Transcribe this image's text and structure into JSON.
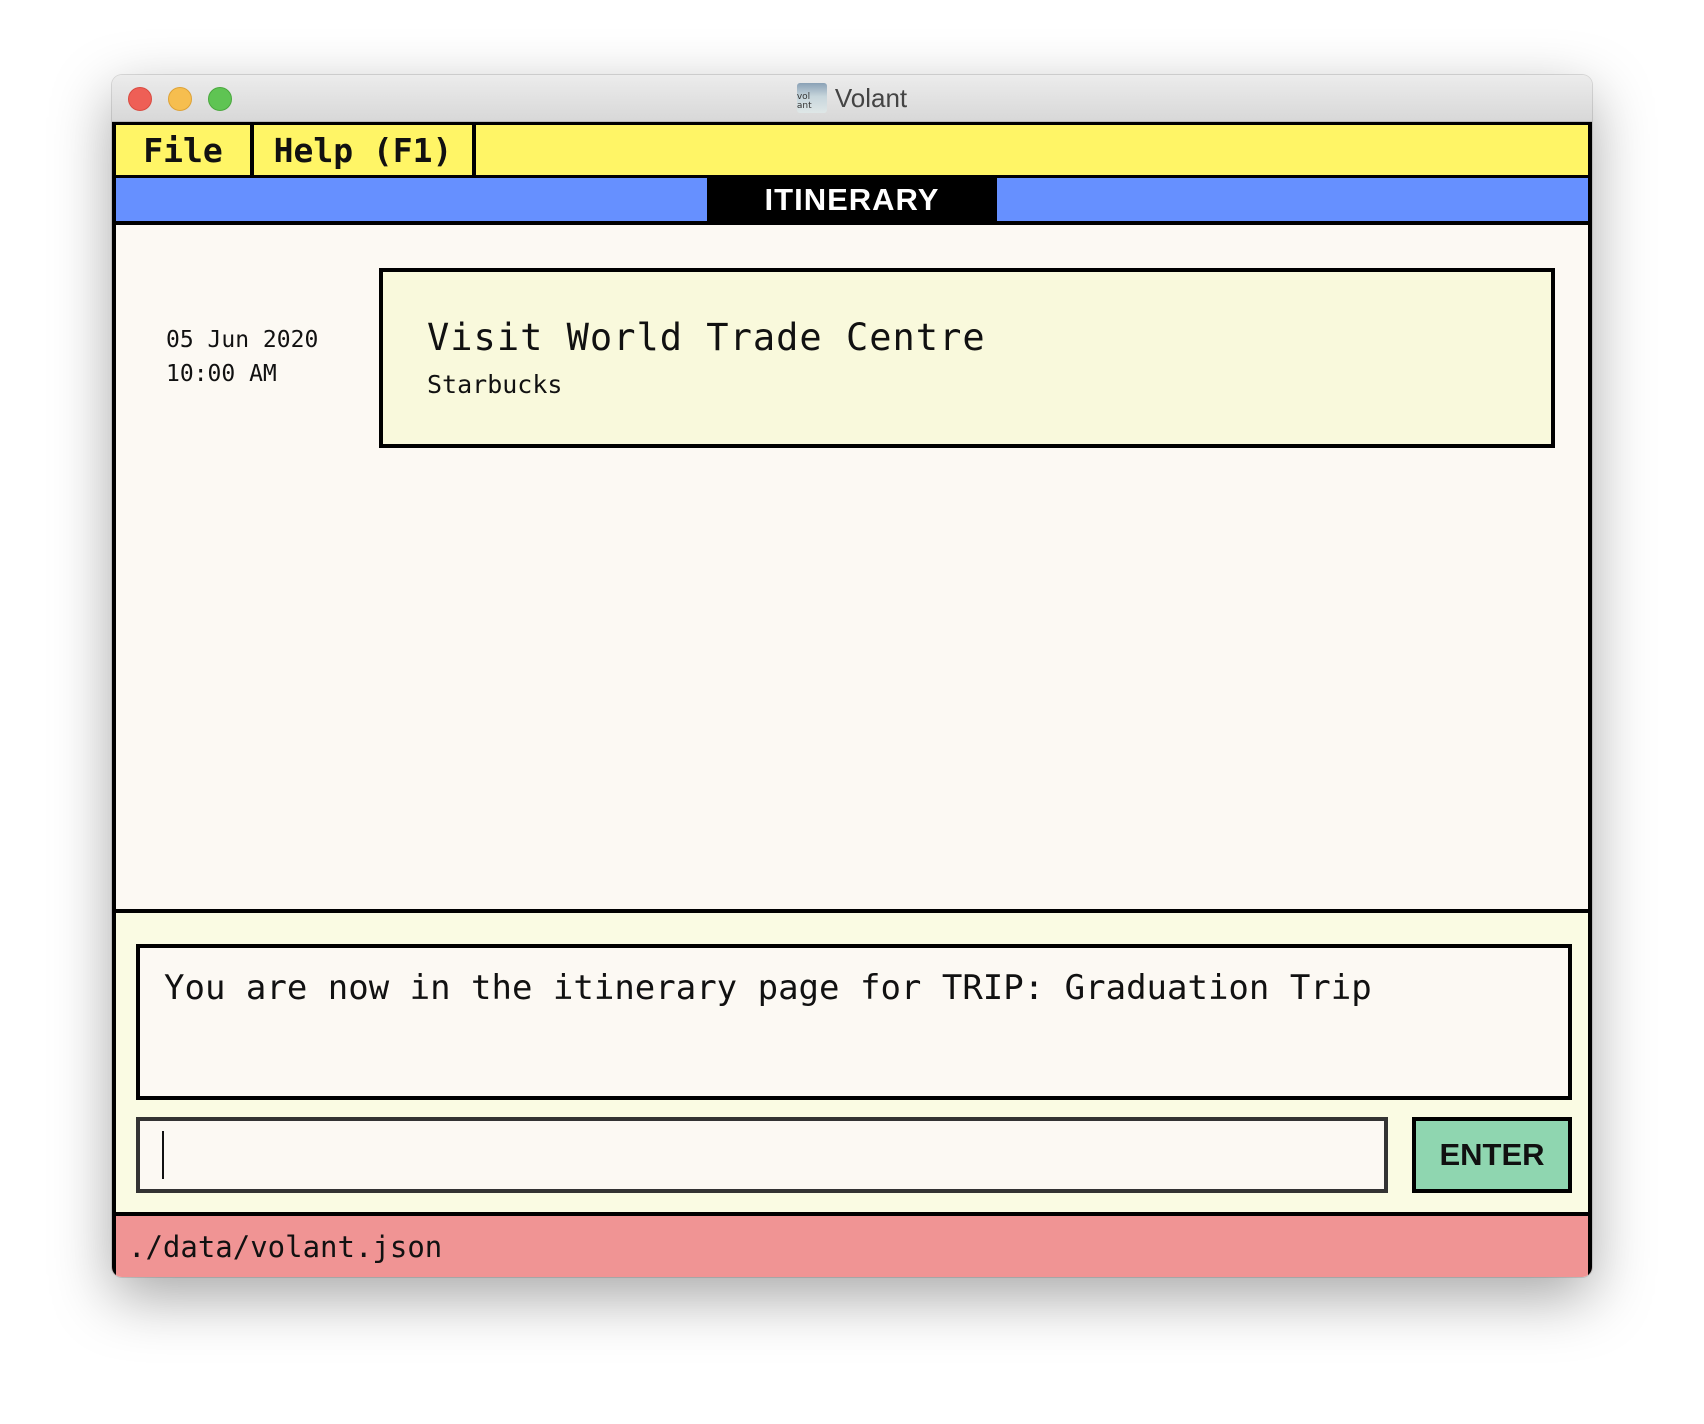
{
  "window": {
    "title": "Volant",
    "icon_label": "vol ant"
  },
  "menu": {
    "file": "File",
    "help": "Help (F1)"
  },
  "tab": {
    "label": "ITINERARY"
  },
  "itinerary": {
    "items": [
      {
        "date": "05 Jun 2020",
        "time": "10:00 AM",
        "title": "Visit World Trade Centre",
        "location": "Starbucks"
      }
    ]
  },
  "result": {
    "message": "You are now in the itinerary page for TRIP: Graduation Trip"
  },
  "command": {
    "value": "",
    "button_label": "ENTER"
  },
  "status": {
    "path": "./data/volant.json"
  },
  "colors": {
    "menu_bg": "#fff566",
    "tabstrip_bg": "#6690ff",
    "card_bg": "#f9f9dc",
    "enter_bg": "#8fd6b0",
    "status_bg": "#f09494"
  }
}
